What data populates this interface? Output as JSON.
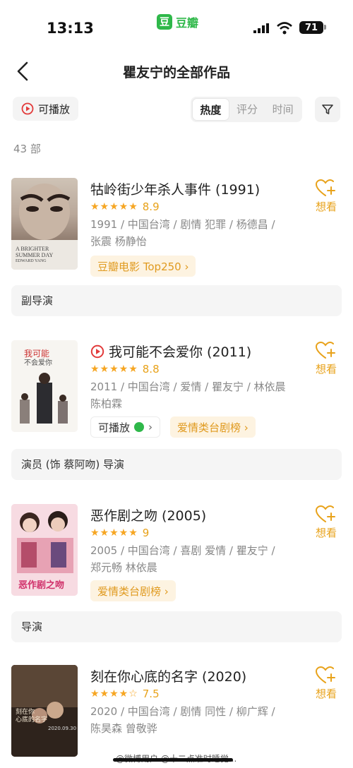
{
  "status": {
    "time": "13:13",
    "app_name": "豆瓣",
    "app_logo": "豆",
    "battery": "71"
  },
  "nav": {
    "title": "瞿友宁的全部作品"
  },
  "filters": {
    "playable_label": "可播放",
    "sort_tabs": [
      "热度",
      "评分",
      "时间"
    ],
    "active_sort": "热度"
  },
  "count": "43 部",
  "works": [
    {
      "title": "牯岭街少年杀人事件 (1991)",
      "rating": 8.9,
      "stars": "★★★★★",
      "meta": "1991 / 中国台湾 / 剧情 犯罪 / 杨德昌 / 张震 杨静怡",
      "tags": [
        {
          "label": "豆瓣电影 Top250 ›",
          "style": "orange"
        }
      ],
      "poster_text": [
        "A BRIGHTER",
        "SUMMER DAY",
        "EDWARD YANG"
      ],
      "wish_label": "想看",
      "role": "副导演"
    },
    {
      "title": "我可能不会爱你 (2011)",
      "rating": 8.8,
      "stars": "★★★★★",
      "meta": "2011 / 中国台湾 / 爱情 / 瞿友宁 / 林依晨 陈柏霖",
      "tags": [
        {
          "label": "可播放",
          "style": "gray"
        },
        {
          "label": "爱情类台剧榜 ›",
          "style": "orange"
        }
      ],
      "poster_text": [
        "我可能",
        "不会爱你"
      ],
      "wish_label": "想看",
      "role": "演员 (饰 蔡阿吻) 导演"
    },
    {
      "title": "恶作剧之吻 (2005)",
      "rating": 9.0,
      "stars": "★★★★★",
      "meta": "2005 / 中国台湾 / 喜剧 爱情 / 瞿友宁 / 郑元畅 林依晨",
      "tags": [
        {
          "label": "爱情类台剧榜 ›",
          "style": "orange"
        }
      ],
      "poster_text": [
        "恶作剧之吻"
      ],
      "wish_label": "想看",
      "role": "导演"
    },
    {
      "title": "刻在你心底的名字 (2020)",
      "rating": 7.5,
      "stars": "★★★★☆",
      "meta": "2020 / 中国台湾 / 剧情 同性 / 柳广辉 / 陈昊森 曾敬骅",
      "tags": [],
      "poster_text": [
        "刻在你",
        "心底的名字",
        "2020.09.30"
      ],
      "wish_label": "想看",
      "role": ""
    }
  ],
  "watermark": "@微博用户 @十二点准时睡觉...",
  "colors": {
    "accent": "#f6a623",
    "orange_text": "#e09a1f",
    "play_red": "#e23b3b",
    "douban_green": "#2fb84a"
  }
}
